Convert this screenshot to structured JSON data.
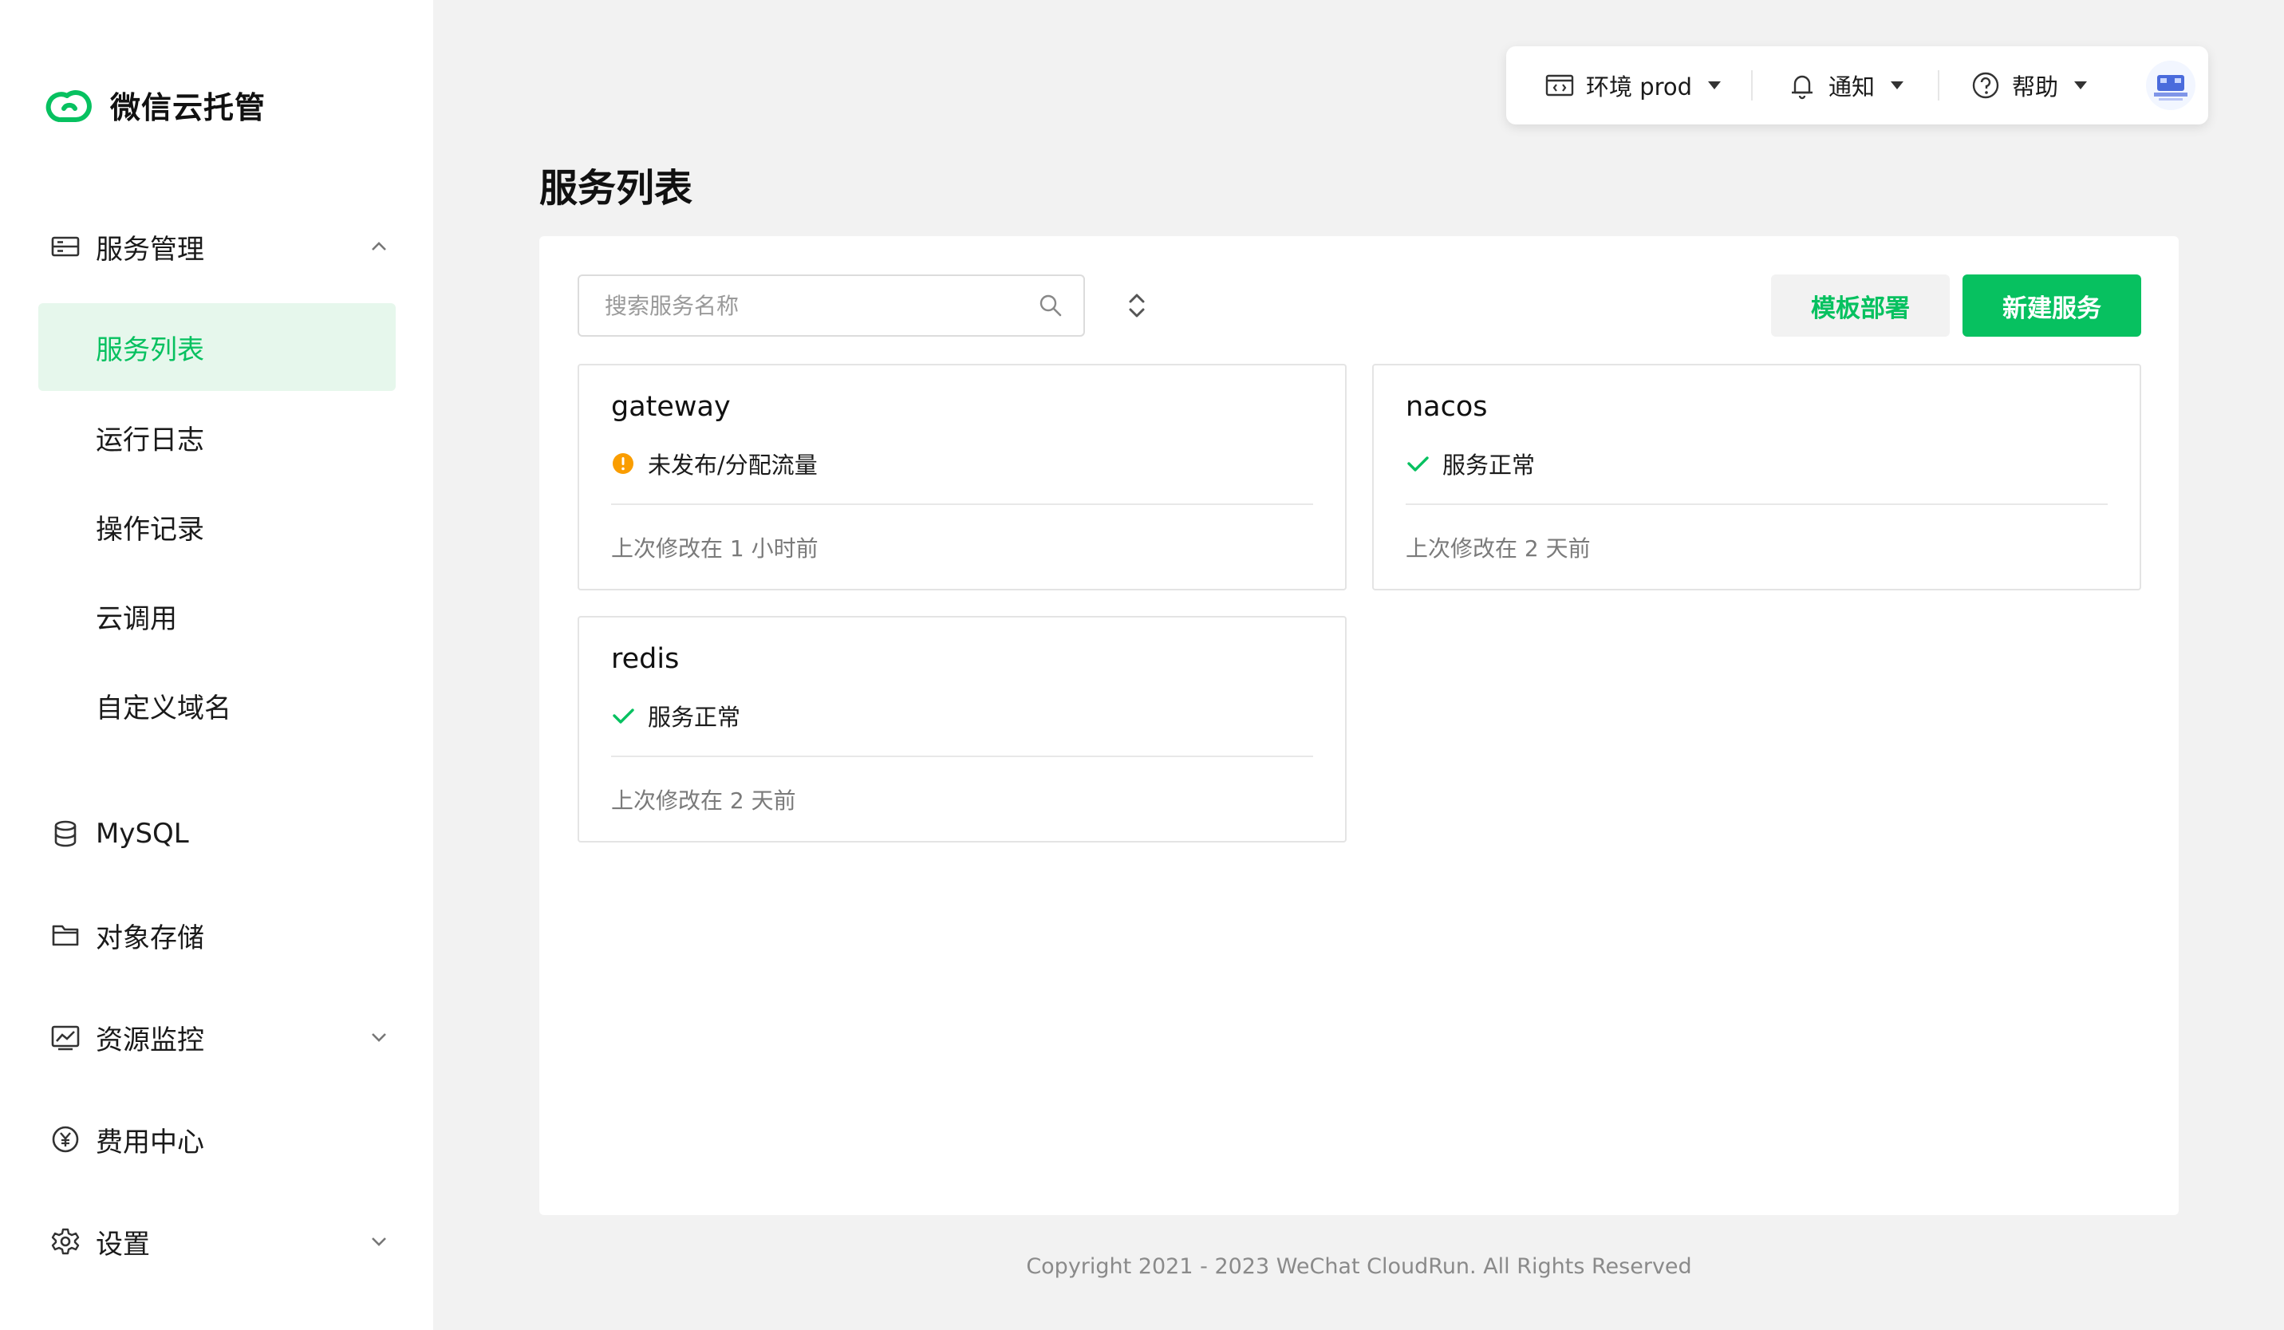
{
  "app": {
    "name": "微信云托管"
  },
  "sidebar": {
    "group_service": {
      "label": "服务管理"
    },
    "items": [
      {
        "label": "服务列表"
      },
      {
        "label": "运行日志"
      },
      {
        "label": "操作记录"
      },
      {
        "label": "云调用"
      },
      {
        "label": "自定义域名"
      }
    ],
    "mysql": {
      "label": "MySQL"
    },
    "storage": {
      "label": "对象存储"
    },
    "monitor": {
      "label": "资源监控"
    },
    "billing": {
      "label": "费用中心"
    },
    "settings": {
      "label": "设置"
    }
  },
  "topbar": {
    "env_label": "环境 prod",
    "notify_label": "通知",
    "help_label": "帮助"
  },
  "page": {
    "title": "服务列表"
  },
  "search": {
    "placeholder": "搜索服务名称"
  },
  "buttons": {
    "template_deploy": "模板部署",
    "new_service": "新建服务"
  },
  "services": [
    {
      "name": "gateway",
      "status": "未发布/分配流量",
      "status_type": "warning",
      "modified": "上次修改在 1 小时前"
    },
    {
      "name": "nacos",
      "status": "服务正常",
      "status_type": "ok",
      "modified": "上次修改在 2 天前"
    },
    {
      "name": "redis",
      "status": "服务正常",
      "status_type": "ok",
      "modified": "上次修改在 2 天前"
    }
  ],
  "footer": {
    "copyright": "Copyright 2021 - 2023 WeChat CloudRun. All Rights Reserved"
  },
  "colors": {
    "accent": "#07c160",
    "warning": "#fa9d00"
  }
}
